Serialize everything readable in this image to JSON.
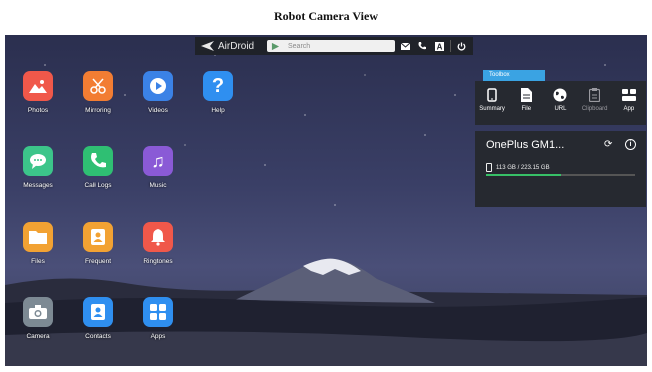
{
  "page_title": "Robot Camera View",
  "toolbar": {
    "brand": "AirDroid",
    "search_placeholder": "Search"
  },
  "apps": [
    {
      "label": "Photos",
      "icon": "photos-icon",
      "color": "#f0584a"
    },
    {
      "label": "Mirroring",
      "icon": "scissors-icon",
      "color": "#f27d33"
    },
    {
      "label": "Videos",
      "icon": "play-icon",
      "color": "#3b82e6"
    },
    {
      "label": "Help",
      "icon": "question-icon",
      "color": "#2f8ff0"
    },
    {
      "label": "Messages",
      "icon": "chat-icon",
      "color": "#3cc58a"
    },
    {
      "label": "Call Logs",
      "icon": "phone-icon",
      "color": "#2fbf73"
    },
    {
      "label": "Music",
      "icon": "music-icon",
      "color": "#8a5ad6"
    },
    {
      "label": "Files",
      "icon": "folder-icon",
      "color": "#f2a233"
    },
    {
      "label": "Frequent",
      "icon": "contact-card-icon",
      "color": "#f2a233"
    },
    {
      "label": "Ringtones",
      "icon": "bell-icon",
      "color": "#f0584a"
    },
    {
      "label": "Camera",
      "icon": "camera-icon",
      "color": "#7d8a94"
    },
    {
      "label": "Contacts",
      "icon": "contacts-icon",
      "color": "#2f8ff0"
    },
    {
      "label": "Apps",
      "icon": "grid-icon",
      "color": "#2f8ff0"
    }
  ],
  "toolbox": {
    "tab_label": "Toolbox",
    "tools": [
      {
        "label": "Summary",
        "icon": "phone-outline-icon"
      },
      {
        "label": "File",
        "icon": "file-icon"
      },
      {
        "label": "URL",
        "icon": "globe-icon"
      },
      {
        "label": "Clipboard",
        "icon": "clipboard-icon"
      },
      {
        "label": "App",
        "icon": "app-icon"
      }
    ]
  },
  "device": {
    "name": "OnePlus GM1...",
    "storage_text": "113 GB / 223.15 GB",
    "storage_fraction": 0.506
  },
  "colors": {
    "accent": "#3aa3e3",
    "storage_fill": "#37c067",
    "panel": "#262930"
  }
}
